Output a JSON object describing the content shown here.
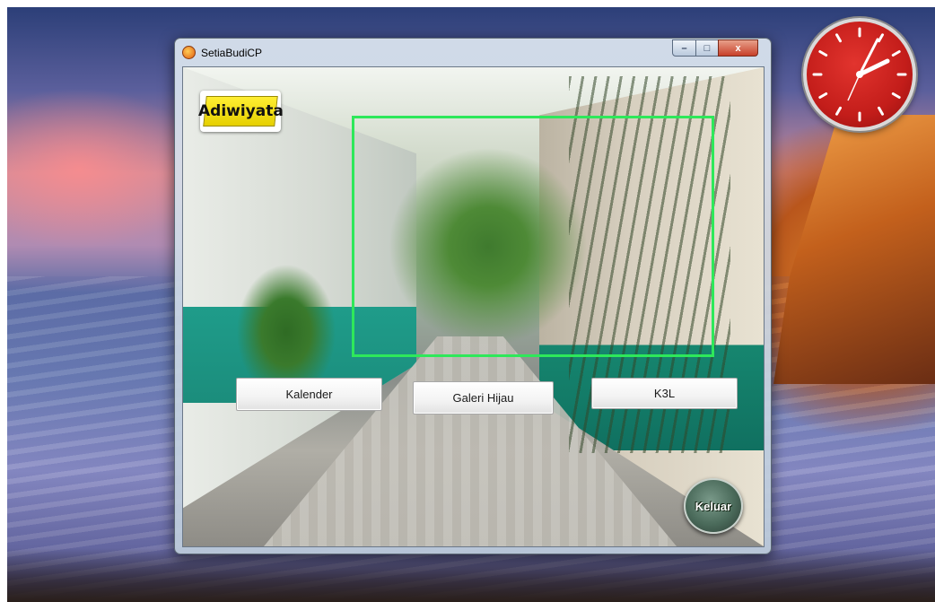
{
  "desktop": {
    "clock_time_shown": "1:12"
  },
  "window": {
    "title": "SetiaBudiCP",
    "controls": {
      "minimize": "–",
      "maximize": "□",
      "close": "x"
    }
  },
  "content": {
    "logo_text": "Adiwiyata",
    "buttons": {
      "kalender": "Kalender",
      "galeri": "Galeri Hijau",
      "k3l": "K3L"
    },
    "exit_label": "Keluar"
  },
  "colors": {
    "frame_accent": "#2ee85a",
    "clock_face": "#d42a26",
    "logo_bg": "#ffee33"
  }
}
